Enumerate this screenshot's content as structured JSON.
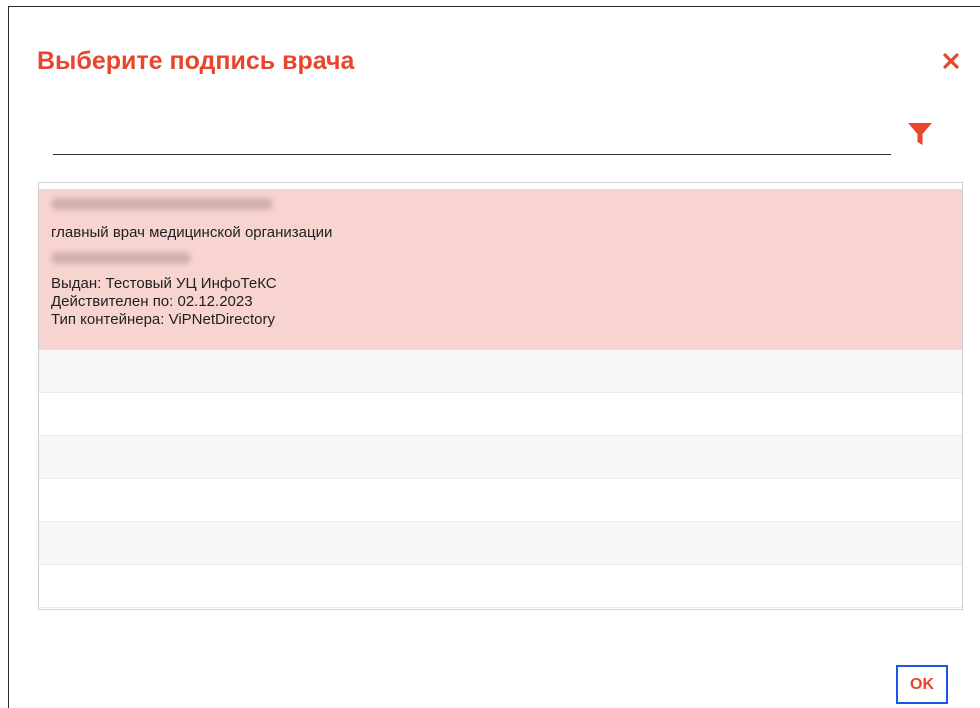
{
  "dialog": {
    "title": "Выберите подпись врача",
    "close_icon": "close-icon",
    "accent_color": "#e8452c",
    "focus_color": "#1a56e8"
  },
  "filter": {
    "value": "",
    "placeholder": "",
    "icon": "filter-icon"
  },
  "certificates": [
    {
      "owner_name": "",
      "position": "главный врач медицинской организации",
      "organization": "",
      "issued_by": "Выдан: Тестовый УЦ ИнфоТеКС",
      "valid_until": "Действителен по: 02.12.2023",
      "container_type": "Тип контейнера: ViPNetDirectory",
      "selected": true,
      "highlight_color": "#f8d4d1"
    }
  ],
  "footer": {
    "ok_label": "OK"
  }
}
